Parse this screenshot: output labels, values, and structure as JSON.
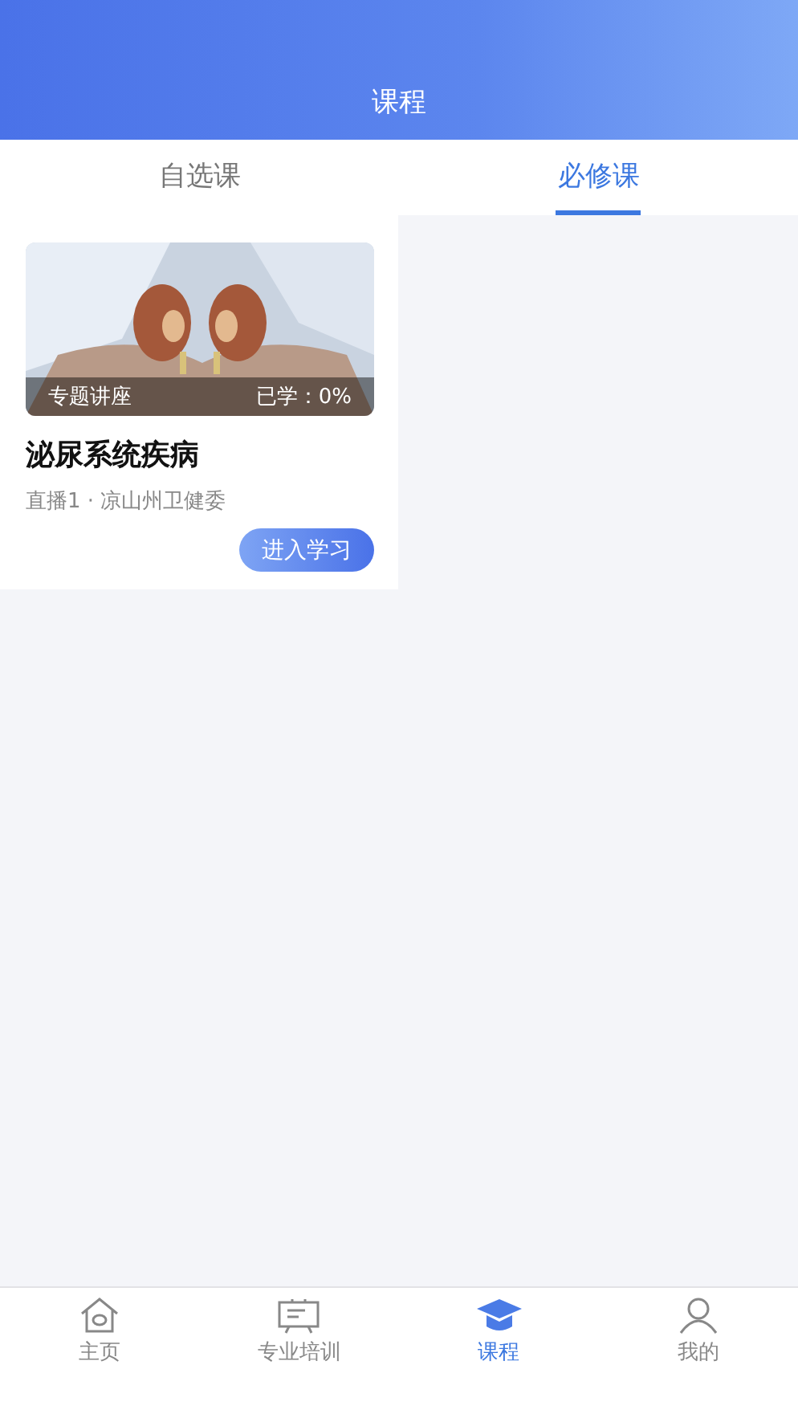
{
  "header": {
    "title": "课程"
  },
  "tabs": [
    {
      "label": "自选课",
      "selected": false
    },
    {
      "label": "必修课",
      "selected": true
    }
  ],
  "courses": [
    {
      "kind": "picture",
      "category": "专题讲座",
      "progress": "已学：0%",
      "title": "泌尿系统疾病",
      "meta": "直播1 · 凉山州卫健委",
      "action": "进入学习"
    }
  ],
  "nav": [
    {
      "kind": "home",
      "label": "主页",
      "selected": false
    },
    {
      "kind": "board",
      "label": "专业培训",
      "selected": false
    },
    {
      "kind": "cap",
      "label": "课程",
      "selected": true
    },
    {
      "kind": "person",
      "label": "我的",
      "selected": false
    }
  ]
}
